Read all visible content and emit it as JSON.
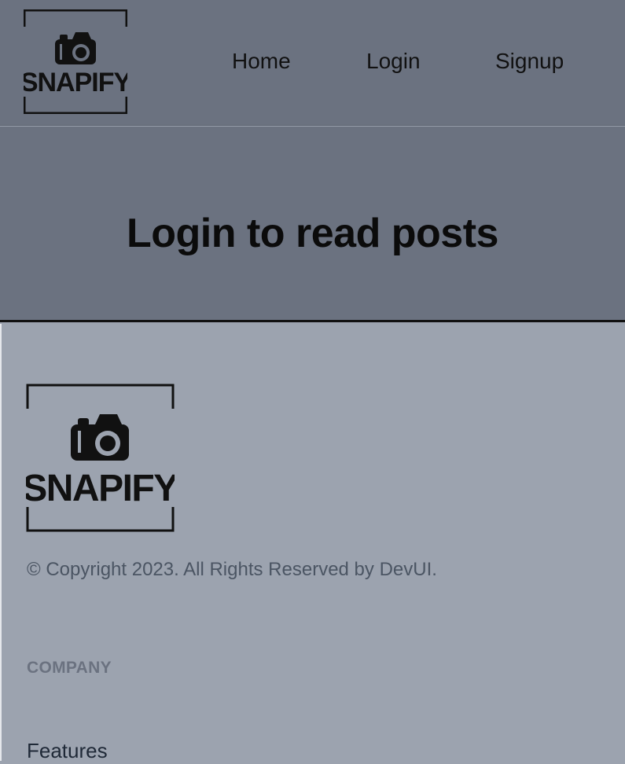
{
  "navbar": {
    "logo_text": "SNAPIFY",
    "links": [
      {
        "label": "Home"
      },
      {
        "label": "Login"
      },
      {
        "label": "Signup"
      }
    ]
  },
  "hero": {
    "title": "Login to read posts"
  },
  "footer": {
    "logo_text": "SNAPIFY",
    "copyright": "© Copyright 2023. All Rights Reserved by DevUI.",
    "company_heading": "COMPANY",
    "links": [
      {
        "label": "Features"
      }
    ]
  },
  "colors": {
    "navbar_bg": "#6b7280",
    "hero_bg": "#6b7280",
    "footer_bg": "#9ca3af",
    "text_dark": "#111111",
    "text_muted": "#4b5563"
  },
  "icons": {
    "logo": "camera-icon"
  }
}
